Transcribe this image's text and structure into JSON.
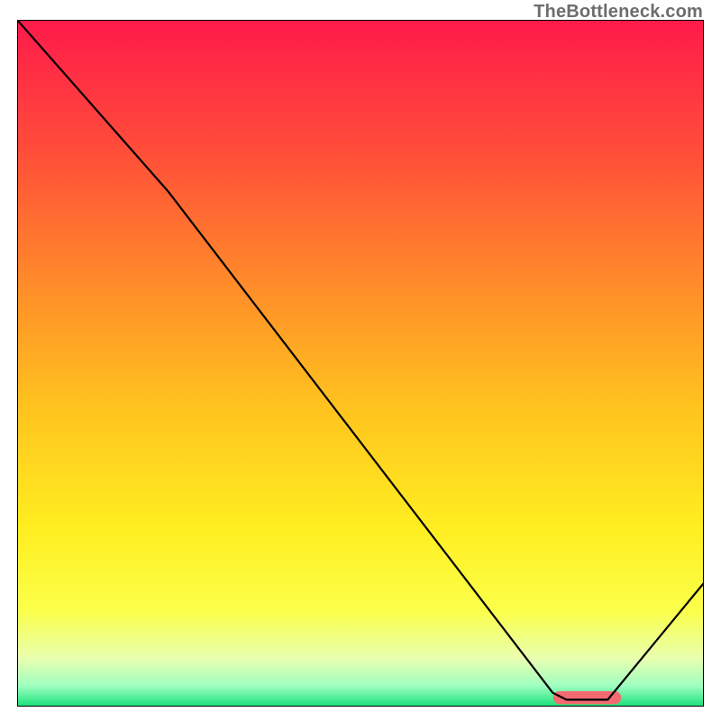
{
  "watermark": "TheBottleneck.com",
  "chart_data": {
    "type": "line",
    "title": "",
    "xlabel": "",
    "ylabel": "",
    "xlim": [
      0,
      100
    ],
    "ylim": [
      0,
      100
    ],
    "background_gradient": [
      {
        "pos": 0.0,
        "color": "#ff1a4b"
      },
      {
        "pos": 0.18,
        "color": "#ff4a3a"
      },
      {
        "pos": 0.38,
        "color": "#ff8a2a"
      },
      {
        "pos": 0.56,
        "color": "#ffc21e"
      },
      {
        "pos": 0.74,
        "color": "#ffee20"
      },
      {
        "pos": 0.86,
        "color": "#fbff4a"
      },
      {
        "pos": 0.93,
        "color": "#e9ffb0"
      },
      {
        "pos": 0.97,
        "color": "#9effc0"
      },
      {
        "pos": 1.0,
        "color": "#18e07a"
      }
    ],
    "series": [
      {
        "name": "bottleneck-curve",
        "color": "#000000",
        "x": [
          0,
          22,
          78,
          80,
          86,
          100
        ],
        "y": [
          100,
          75,
          2,
          1,
          1,
          18
        ]
      }
    ],
    "marker": {
      "name": "optimal-range",
      "color": "#f46a6f",
      "x0": 79,
      "x1": 87,
      "y": 1.3,
      "thickness": 1.9
    }
  }
}
